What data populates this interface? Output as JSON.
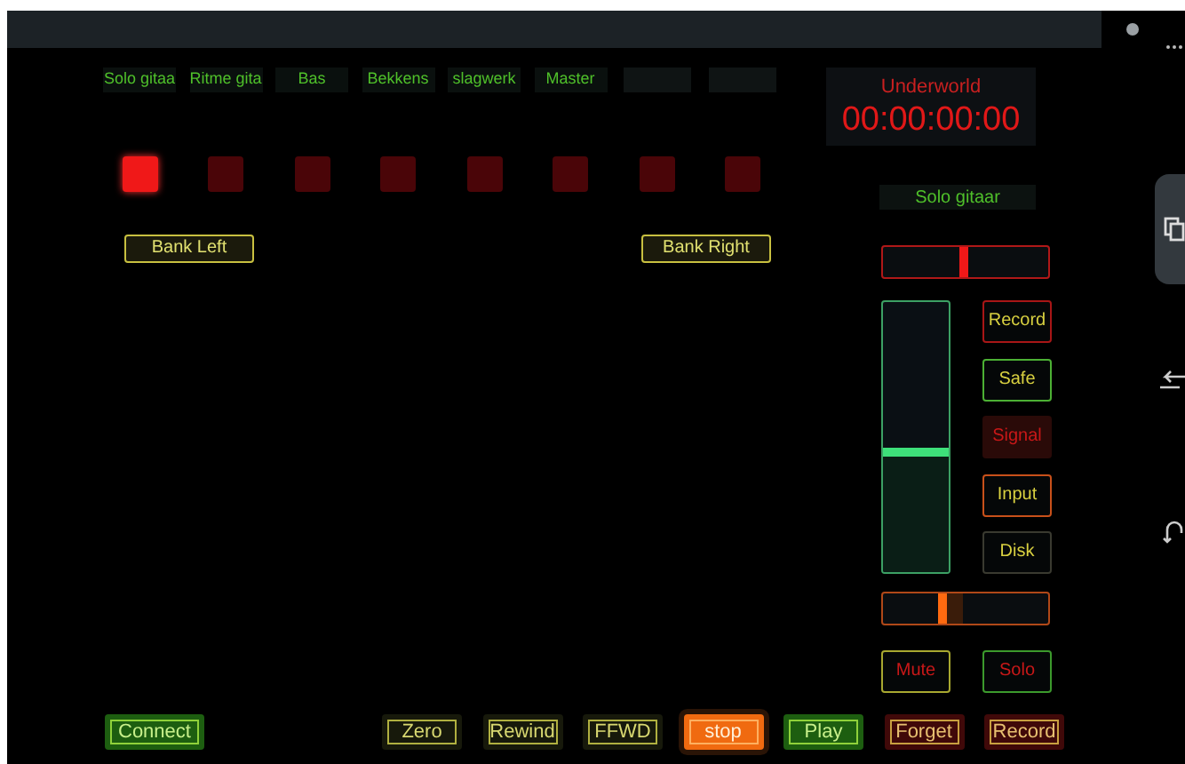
{
  "channels": [
    {
      "label": "Solo gitaa",
      "armed": true
    },
    {
      "label": "Ritme gita",
      "armed": false
    },
    {
      "label": "Bas",
      "armed": false
    },
    {
      "label": "Bekkens",
      "armed": false
    },
    {
      "label": "slagwerk",
      "armed": false
    },
    {
      "label": "Master",
      "armed": false
    },
    {
      "armed": false
    },
    {
      "armed": false
    }
  ],
  "bank_buttons": [
    "Bank Left",
    "Bank Right"
  ],
  "display": {
    "title": "Underworld",
    "time": "00:00:00:00"
  },
  "selected_track": "Solo gitaar",
  "pan": {
    "level": 0.48
  },
  "fader": {
    "level": 0.44
  },
  "trim": {
    "level": 0.36
  },
  "track_buttons": [
    {
      "label": "Record",
      "kind": "record"
    },
    {
      "label": "Safe",
      "kind": "safe"
    },
    {
      "label": "Signal",
      "kind": "signal"
    },
    {
      "label": "Input",
      "kind": "input"
    },
    {
      "label": "Disk",
      "kind": "disk"
    }
  ],
  "mute_solo": [
    {
      "label": "Mute",
      "kind": "mute"
    },
    {
      "label": "Solo",
      "kind": "solo"
    }
  ],
  "bottom_bar": {
    "left": [
      {
        "label": "Connect",
        "kind": "green"
      }
    ],
    "right": [
      {
        "label": "Zero",
        "kind": "dim"
      },
      {
        "label": "Rewind",
        "kind": "dim"
      },
      {
        "label": "FFWD",
        "kind": "dim"
      },
      {
        "label": "stop",
        "kind": "orange"
      },
      {
        "label": "Play",
        "kind": "green"
      },
      {
        "label": "Forget",
        "kind": "red"
      },
      {
        "label": "Record",
        "kind": "red"
      }
    ]
  }
}
